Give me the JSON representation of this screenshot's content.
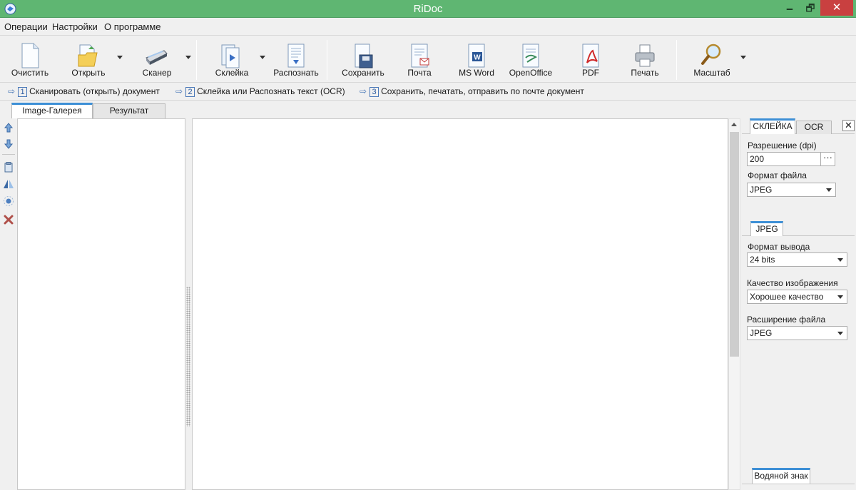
{
  "window": {
    "title": "RiDoc",
    "minimize": "🗕",
    "maximize": "🗗",
    "close": "✕"
  },
  "menu": [
    "Операции",
    "Настройки",
    "О программе"
  ],
  "toolbar": {
    "clear": "Очистить",
    "open": "Открыть",
    "scanner": "Сканер",
    "glue": "Склейка",
    "recognize": "Распознать",
    "save": "Сохранить",
    "mail": "Почта",
    "msword": "MS Word",
    "openoffice": "OpenOffice",
    "pdf": "PDF",
    "print": "Печать",
    "zoom": "Масштаб"
  },
  "steps": [
    {
      "num": "1",
      "text": "Сканировать (открыть) документ"
    },
    {
      "num": "2",
      "text": "Склейка или Распознать текст (OCR)"
    },
    {
      "num": "3",
      "text": "Сохранить, печатать, отправить по почте документ"
    }
  ],
  "tabs": {
    "gallery": "Image-Галерея",
    "result": "Результат"
  },
  "right_panel": {
    "tab_glue": "СКЛЕЙКА",
    "tab_ocr": "OCR",
    "close": "✕",
    "resolution_label": "Разрешение (dpi)",
    "resolution_value": "200",
    "resolution_button": "···",
    "file_format_label": "Формат файла",
    "file_format_value": "JPEG",
    "subtab_jpeg": "JPEG",
    "output_format_label": "Формат вывода",
    "output_format_value": "24 bits",
    "quality_label": "Качество изображения",
    "quality_value": "Хорошее качество",
    "extension_label": "Расширение файла",
    "extension_value": "JPEG",
    "watermark_tab": "Водяной знак"
  },
  "colors": {
    "titlebar": "#5fb672",
    "accent": "#3d8fd6",
    "close": "#c94040"
  }
}
